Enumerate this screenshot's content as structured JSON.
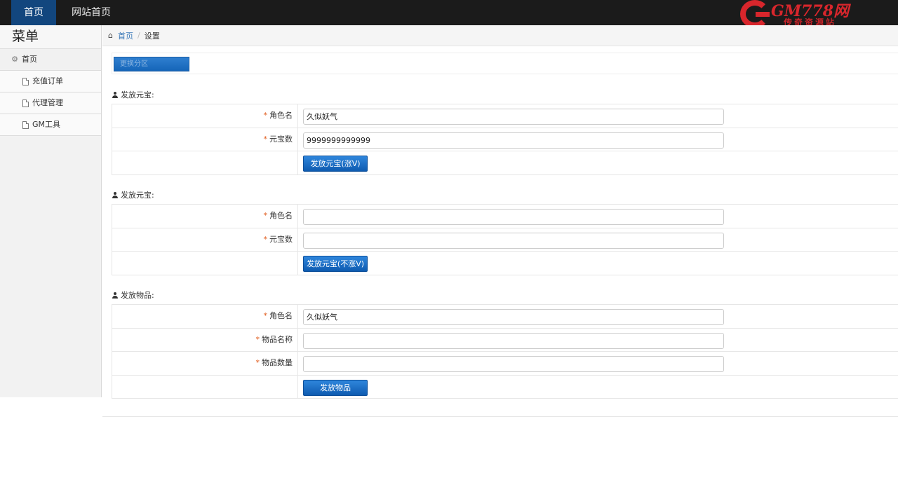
{
  "topbar": {
    "nav": [
      {
        "label": "首页",
        "active": true
      },
      {
        "label": "网站首页",
        "active": false
      }
    ],
    "logo": {
      "brand": "GM778网",
      "sub": "传奇资源站"
    }
  },
  "sidebar": {
    "title": "菜单",
    "items": [
      {
        "label": "首页",
        "icon": "gear-icon",
        "level": "top"
      },
      {
        "label": "充值订单",
        "icon": "document-icon",
        "level": "sub"
      },
      {
        "label": "代理管理",
        "icon": "document-icon",
        "level": "sub"
      },
      {
        "label": "GM工具",
        "icon": "document-icon",
        "level": "sub"
      }
    ]
  },
  "breadcrumb": {
    "home": "首页",
    "current": "设置"
  },
  "switch_button": "更换分区",
  "sections": [
    {
      "title": "发放元宝:",
      "fields": [
        {
          "label": "角色名",
          "value": ""
        },
        {
          "label": "元宝数",
          "value": ""
        }
      ],
      "values": [
        "久似妖气",
        "9999999999999"
      ],
      "button": "发放元宝(涨V)"
    },
    {
      "title": "发放元宝:",
      "fields": [
        {
          "label": "角色名"
        },
        {
          "label": "元宝数"
        }
      ],
      "values": [
        "",
        ""
      ],
      "button": "发放元宝(不涨V)"
    },
    {
      "title": "发放物品:",
      "fields": [
        {
          "label": "角色名"
        },
        {
          "label": "物品名称"
        },
        {
          "label": "物品数量"
        }
      ],
      "values": [
        "久似妖气",
        "",
        ""
      ],
      "button": "发放物品"
    }
  ],
  "required_mark": "*",
  "colors": {
    "topbar": "#1b1b1b",
    "active_nav": "#12467e",
    "button": "#1565b8",
    "required": "#e05a1a",
    "logo": "#d8262c"
  }
}
